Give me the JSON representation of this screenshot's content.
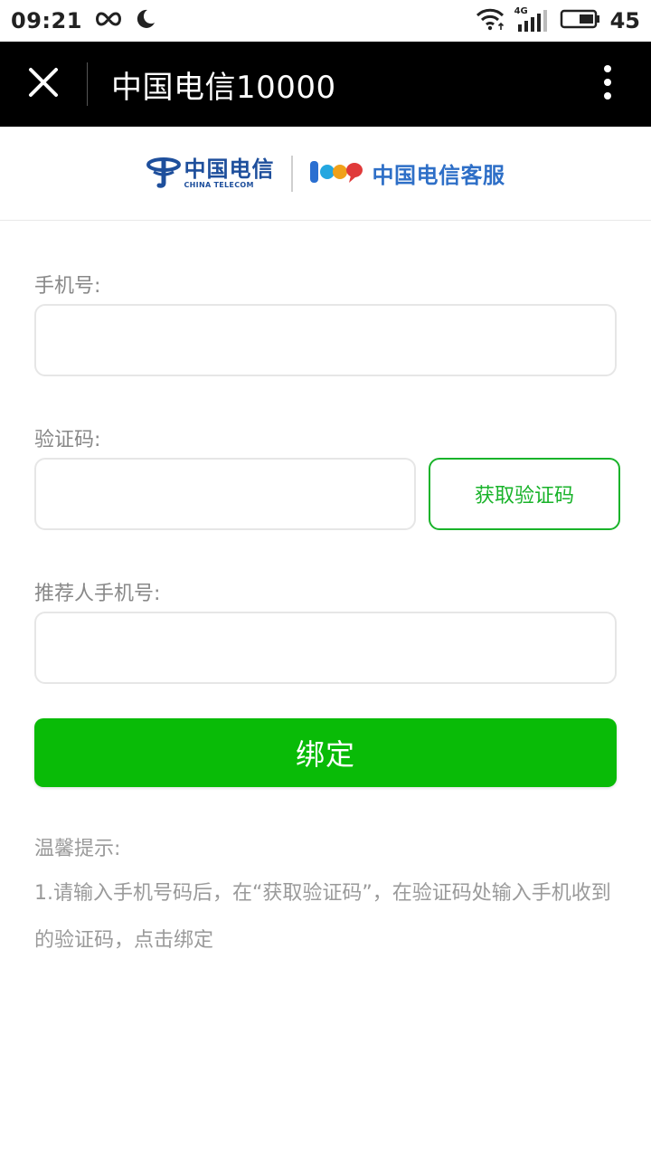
{
  "status_bar": {
    "time": "09:21",
    "network_type": "4G",
    "battery_level": "45",
    "icons": [
      "infinity-icon",
      "moon-icon",
      "wifi-icon",
      "signal-icon",
      "battery-icon"
    ]
  },
  "app_bar": {
    "title": "中国电信10000",
    "icons": {
      "close": "close-icon",
      "more": "more-vertical-icon"
    }
  },
  "logo": {
    "brand_cn": "中国电信",
    "brand_en": "CHINA TELECOM",
    "service_name": "中国电信客服"
  },
  "form": {
    "phone": {
      "label": "手机号:",
      "value": "",
      "placeholder": ""
    },
    "code": {
      "label": "验证码:",
      "value": "",
      "placeholder": ""
    },
    "get_code_button": "获取验证码",
    "referrer": {
      "label": "推荐人手机号:",
      "value": "",
      "placeholder": ""
    },
    "bind_button": "绑定"
  },
  "tips": {
    "title": "温馨提示:",
    "body": "1.请输入手机号码后，在“获取验证码”，在验证码处输入手机收到的验证码，点击绑定"
  },
  "colors": {
    "accent_green": "#09bb07",
    "outline_green": "#19b32a",
    "brand_blue": "#1e4f9c",
    "app_bar_bg": "#000000"
  }
}
